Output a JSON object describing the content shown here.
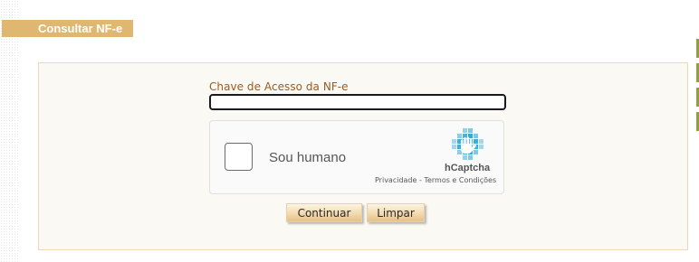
{
  "header": {
    "title": "Consultar NF-e"
  },
  "form": {
    "access_key_label": "Chave de Acesso da NF-e",
    "access_key_value": ""
  },
  "captcha": {
    "checkbox_label": "Sou humano",
    "brand": "hCaptcha",
    "privacy_link": "Privacidade",
    "separator": " - ",
    "terms_link": "Termos e Condições",
    "logo_icon": "hcaptcha-hand-icon"
  },
  "buttons": {
    "continue_label": "Continuar",
    "clear_label": "Limpar"
  },
  "colors": {
    "title_bar": "#e0b771",
    "label_text": "#9a5a24",
    "form_background": "#fbf9f3",
    "form_border": "#ead9b4",
    "right_marks": "#8fa03a",
    "captcha_logo_blue": "#1d9fd6"
  }
}
